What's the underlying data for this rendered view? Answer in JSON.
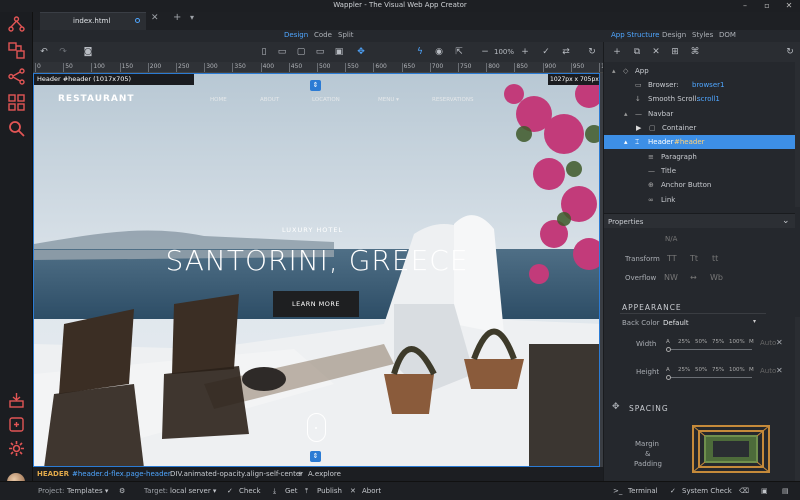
{
  "window": {
    "title": "Wappler - The Visual Web App Creator"
  },
  "tab": {
    "name": "index.html"
  },
  "view_switch": {
    "design": "Design",
    "code": "Code",
    "split": "Split"
  },
  "right_tabs": {
    "app_structure": "App Structure",
    "design": "Design",
    "styles": "Styles",
    "dom": "DOM"
  },
  "toolbar": {
    "zoom": "100%"
  },
  "ruler": {
    "ticks": [
      "0",
      "50",
      "100",
      "150",
      "200",
      "250",
      "300",
      "350",
      "400",
      "450",
      "500",
      "550",
      "600",
      "650",
      "700",
      "750",
      "800",
      "850",
      "900",
      "950",
      "1000"
    ]
  },
  "canvas": {
    "header_badge": "Header #header (1017x705)",
    "size_badge": "1027px x 705px",
    "brand": "RESTAURANT",
    "nav": [
      "HOME",
      "ABOUT",
      "LOCATION",
      "MENU ▾",
      "RESERVATIONS"
    ],
    "kicker": "LUXURY HOTEL",
    "headline": "SANTORINI, GREECE",
    "cta": "LEARN MORE"
  },
  "tree": {
    "app": "App",
    "browser_prefix": "Browser: ",
    "browser_id": "browser1",
    "scroll_prefix": "Smooth Scroll: ",
    "scroll_id": "scroll1",
    "navbar": "Navbar",
    "container": "Container",
    "header": "Header",
    "header_id": "#header",
    "paragraph": "Paragraph",
    "title": "Title",
    "anchor": "Anchor Button",
    "link": "Link"
  },
  "properties": {
    "heading": "Properties",
    "na": "N/A",
    "transform_label": "Transform",
    "transform_opts": [
      "TT",
      "Tt",
      "tt"
    ],
    "overflow_label": "Overflow",
    "overflow_opts": [
      "NW",
      "↔",
      "Wb"
    ],
    "appearance": "APPEARANCE",
    "back_color_label": "Back Color",
    "back_color_value": "Default",
    "width_label": "Width",
    "height_label": "Height",
    "size_steps": [
      "A",
      "25%",
      "50%",
      "75%",
      "100%",
      "M"
    ],
    "auto_placeholder": "Auto",
    "spacing": "SPACING",
    "margin_label": "Margin",
    "amp": "&",
    "padding_label": "Padding"
  },
  "breadcrumb": {
    "part1": "HEADER",
    "part2": "#header.d-flex.page-header",
    "part3": "DIV.animated-opacity.align-self-center",
    "sep": "+",
    "part4": "A.explore"
  },
  "status": {
    "project_label": "Project:",
    "project": "Templates ▾",
    "target_label": "Target:",
    "target": "local server ▾",
    "check": "Check",
    "get": "Get",
    "publish": "Publish",
    "abort": "Abort",
    "terminal": "Terminal",
    "system_check": "System Check"
  },
  "colors": {
    "accent": "#2b7bd4",
    "id": "#4fa6ff",
    "highlight": "#e0a84a"
  }
}
